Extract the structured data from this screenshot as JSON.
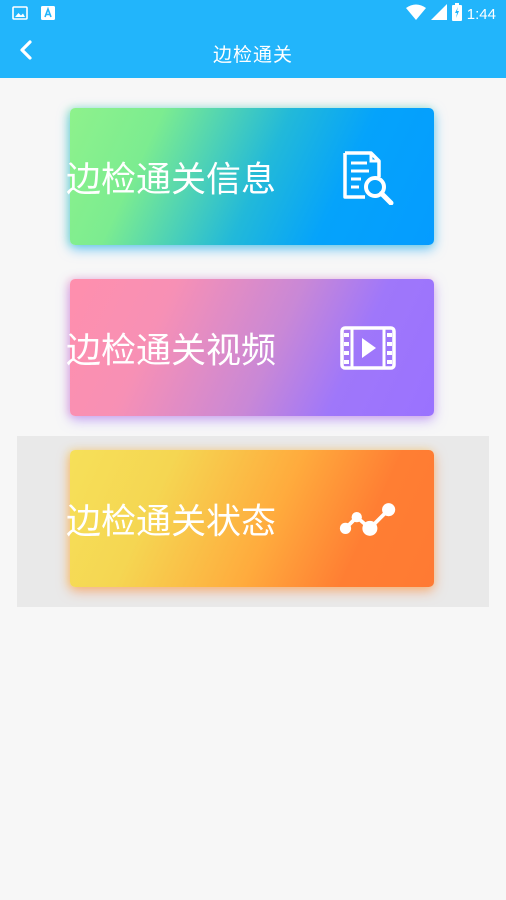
{
  "status_bar": {
    "time": "1:44",
    "icons": [
      "image-icon",
      "font-icon",
      "wifi-icon",
      "signal-icon",
      "battery-icon"
    ]
  },
  "app_bar": {
    "title": "边检通关",
    "back_icon": "chevron-left-icon"
  },
  "cards": [
    {
      "label": "边检通关信息",
      "icon": "document-search-icon",
      "colors": [
        "#8ef28c",
        "#059cff"
      ]
    },
    {
      "label": "边检通关视频",
      "icon": "video-film-icon",
      "colors": [
        "#ff8fad",
        "#9a72ff"
      ]
    },
    {
      "label": "边检通关状态",
      "icon": "line-chart-icon",
      "colors": [
        "#f6e059",
        "#ff7a33"
      ]
    }
  ],
  "colors": {
    "primary": "#22b5fb",
    "background": "#f7f7f7",
    "selected_row": "#e9e9e9"
  }
}
